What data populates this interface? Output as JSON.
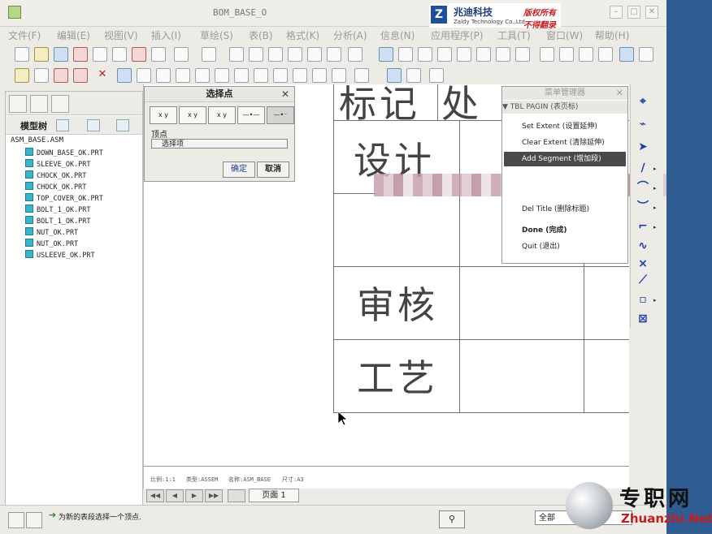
{
  "window": {
    "title": "BOM_BASE_O"
  },
  "watermark": {
    "logo": "Z",
    "company_cn": "兆迪科技",
    "company_en": "Zaldy Technology Co.,Ltd.",
    "right1": "版权所有",
    "right2": "不得翻录"
  },
  "menubar": [
    "文件(F)",
    "编辑(E)",
    "视图(V)",
    "插入(I)",
    "草绘(S)",
    "表(B)",
    "格式(K)",
    "分析(A)",
    "信息(N)",
    "应用程序(P)",
    "工具(T)",
    "窗口(W)",
    "帮助(H)"
  ],
  "left_panel": {
    "header_label": "模型树",
    "root": "ASM_BASE.ASM",
    "items": [
      "DOWN_BASE_OK.PRT",
      "SLEEVE_OK.PRT",
      "CHOCK_OK.PRT",
      "CHOCK_OK.PRT",
      "TOP_COVER_OK.PRT",
      "BOLT_1_OK.PRT",
      "BOLT_1_OK.PRT",
      "NUT_OK.PRT",
      "NUT_OK.PRT",
      "USLEEVE_OK.PRT"
    ]
  },
  "drawing": {
    "cell_labels": [
      "标记",
      "处",
      "设计",
      "审核",
      "工艺"
    ],
    "info_line": [
      "比例:1:1",
      "类型:ASSEM",
      "名称:ASM_BASE",
      "尺寸:A3"
    ]
  },
  "select_point_dialog": {
    "title": "选择点",
    "close": "✕",
    "tool_buttons": [
      "x y",
      "x y",
      "x y",
      "—•—",
      "—•⁻"
    ],
    "vertex_label": "顶点",
    "field_value": "选择项",
    "ok": "确定",
    "cancel": "取消"
  },
  "menu_manager": {
    "title": "菜单管理器",
    "close": "✕",
    "subtitle": "▼ TBL PAGIN (表页标)",
    "items": [
      {
        "label": "Set Extent (设置延伸)",
        "selected": false,
        "bold": false
      },
      {
        "label": "Clear Extent (清除延伸)",
        "selected": false,
        "bold": false
      },
      {
        "label": "Add Segment (增加段)",
        "selected": true,
        "bold": false
      },
      {
        "label": "Del Title (删除标题)",
        "selected": false,
        "bold": false
      },
      {
        "label": "Done (完成)",
        "selected": false,
        "bold": true
      },
      {
        "label": "Quit (退出)",
        "selected": false,
        "bold": false
      }
    ]
  },
  "pagebar": {
    "page_label": "页面 1",
    "nav": [
      "◀◀",
      "◀",
      "▶",
      "▶▶"
    ]
  },
  "status": {
    "message": "为新的表段选择一个顶点.",
    "filter_value": "全部"
  },
  "branding": {
    "cn": "专职网",
    "en": "Zhuanzhi.Net"
  }
}
